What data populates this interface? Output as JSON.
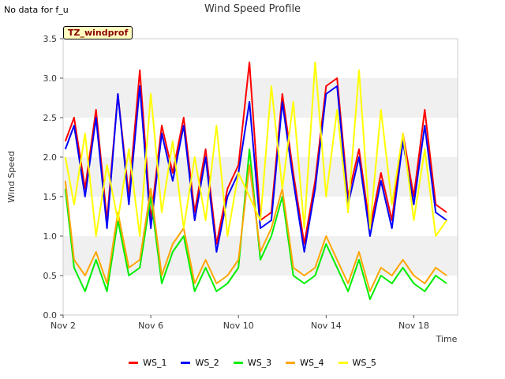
{
  "note": "No data for f_u",
  "chart_data": {
    "type": "line",
    "title": "Wind Speed Profile",
    "site_tag": "TZ_windprof",
    "xlabel": "Time",
    "ylabel": "Wind Speed",
    "ylim": [
      0.0,
      3.5
    ],
    "y_ticks": [
      "0.0",
      "0.5",
      "1.0",
      "1.5",
      "2.0",
      "2.5",
      "3.0",
      "3.5"
    ],
    "x_tick_labels": [
      "Nov 2",
      "Nov 6",
      "Nov 10",
      "Nov 14",
      "Nov 18"
    ],
    "x_tick_days": [
      2,
      6,
      10,
      14,
      18
    ],
    "xlim_days": [
      2,
      20
    ],
    "grid": "horizontal bands",
    "legend_position": "bottom",
    "series": [
      {
        "name": "WS_1",
        "color": "#ff0000",
        "x_days": [
          2.1,
          2.5,
          3.0,
          3.5,
          4.0,
          4.5,
          5.0,
          5.5,
          6.0,
          6.5,
          7.0,
          7.5,
          8.0,
          8.5,
          9.0,
          9.5,
          10.0,
          10.5,
          11.0,
          11.5,
          12.0,
          12.5,
          13.0,
          13.5,
          14.0,
          14.5,
          15.0,
          15.5,
          16.0,
          16.5,
          17.0,
          17.5,
          18.0,
          18.5,
          19.0,
          19.5
        ],
        "y": [
          2.2,
          2.5,
          1.6,
          2.6,
          1.2,
          2.8,
          1.5,
          3.1,
          1.2,
          2.4,
          1.8,
          2.5,
          1.3,
          2.1,
          0.9,
          1.6,
          1.9,
          3.2,
          1.2,
          1.3,
          2.8,
          1.8,
          0.9,
          1.7,
          2.9,
          3.0,
          1.5,
          2.1,
          1.1,
          1.8,
          1.2,
          2.3,
          1.5,
          2.6,
          1.4,
          1.3
        ]
      },
      {
        "name": "WS_2",
        "color": "#0000ff",
        "x_days": [
          2.1,
          2.5,
          3.0,
          3.5,
          4.0,
          4.5,
          5.0,
          5.5,
          6.0,
          6.5,
          7.0,
          7.5,
          8.0,
          8.5,
          9.0,
          9.5,
          10.0,
          10.5,
          11.0,
          11.5,
          12.0,
          12.5,
          13.0,
          13.5,
          14.0,
          14.5,
          15.0,
          15.5,
          16.0,
          16.5,
          17.0,
          17.5,
          18.0,
          18.5,
          19.0,
          19.5
        ],
        "y": [
          2.1,
          2.4,
          1.5,
          2.5,
          1.1,
          2.8,
          1.4,
          2.9,
          1.1,
          2.3,
          1.7,
          2.4,
          1.2,
          2.0,
          0.8,
          1.5,
          1.8,
          2.7,
          1.1,
          1.2,
          2.7,
          1.7,
          0.8,
          1.6,
          2.8,
          2.9,
          1.4,
          2.0,
          1.0,
          1.7,
          1.1,
          2.2,
          1.4,
          2.4,
          1.3,
          1.2
        ]
      },
      {
        "name": "WS_3",
        "color": "#00ee00",
        "x_days": [
          2.1,
          2.5,
          3.0,
          3.5,
          4.0,
          4.5,
          5.0,
          5.5,
          6.0,
          6.5,
          7.0,
          7.5,
          8.0,
          8.5,
          9.0,
          9.5,
          10.0,
          10.5,
          11.0,
          11.5,
          12.0,
          12.5,
          13.0,
          13.5,
          14.0,
          14.5,
          15.0,
          15.5,
          16.0,
          16.5,
          17.0,
          17.5,
          18.0,
          18.5,
          19.0,
          19.5
        ],
        "y": [
          1.6,
          0.6,
          0.3,
          0.7,
          0.3,
          1.2,
          0.5,
          0.6,
          1.5,
          0.4,
          0.8,
          1.0,
          0.3,
          0.6,
          0.3,
          0.4,
          0.6,
          2.1,
          0.7,
          1.0,
          1.5,
          0.5,
          0.4,
          0.5,
          0.9,
          0.6,
          0.3,
          0.7,
          0.2,
          0.5,
          0.4,
          0.6,
          0.4,
          0.3,
          0.5,
          0.4
        ]
      },
      {
        "name": "WS_4",
        "color": "#ffa500",
        "x_days": [
          2.1,
          2.5,
          3.0,
          3.5,
          4.0,
          4.5,
          5.0,
          5.5,
          6.0,
          6.5,
          7.0,
          7.5,
          8.0,
          8.5,
          9.0,
          9.5,
          10.0,
          10.5,
          11.0,
          11.5,
          12.0,
          12.5,
          13.0,
          13.5,
          14.0,
          14.5,
          15.0,
          15.5,
          16.0,
          16.5,
          17.0,
          17.5,
          18.0,
          18.5,
          19.0,
          19.5
        ],
        "y": [
          1.7,
          0.7,
          0.5,
          0.8,
          0.4,
          1.3,
          0.6,
          0.7,
          1.6,
          0.5,
          0.9,
          1.1,
          0.4,
          0.7,
          0.4,
          0.5,
          0.7,
          1.9,
          0.8,
          1.1,
          1.6,
          0.6,
          0.5,
          0.6,
          1.0,
          0.7,
          0.4,
          0.8,
          0.3,
          0.6,
          0.5,
          0.7,
          0.5,
          0.4,
          0.6,
          0.5
        ]
      },
      {
        "name": "WS_5",
        "color": "#ffff00",
        "x_days": [
          2.1,
          2.5,
          3.0,
          3.5,
          4.0,
          4.5,
          5.0,
          5.5,
          6.0,
          6.5,
          7.0,
          7.5,
          8.0,
          8.5,
          9.0,
          9.5,
          10.0,
          10.5,
          11.0,
          11.5,
          12.0,
          12.5,
          13.0,
          13.5,
          14.0,
          14.5,
          15.0,
          15.5,
          16.0,
          16.5,
          17.0,
          17.5,
          18.0,
          18.5,
          19.0,
          19.5
        ],
        "y": [
          2.0,
          1.4,
          2.3,
          1.0,
          1.9,
          1.2,
          2.1,
          1.0,
          2.8,
          1.3,
          2.2,
          1.1,
          2.0,
          1.2,
          2.4,
          1.0,
          1.8,
          1.5,
          1.2,
          2.9,
          1.6,
          2.7,
          1.1,
          3.2,
          1.5,
          2.6,
          1.3,
          3.1,
          1.1,
          2.6,
          1.4,
          2.3,
          1.2,
          2.1,
          1.0,
          1.2
        ]
      }
    ]
  }
}
